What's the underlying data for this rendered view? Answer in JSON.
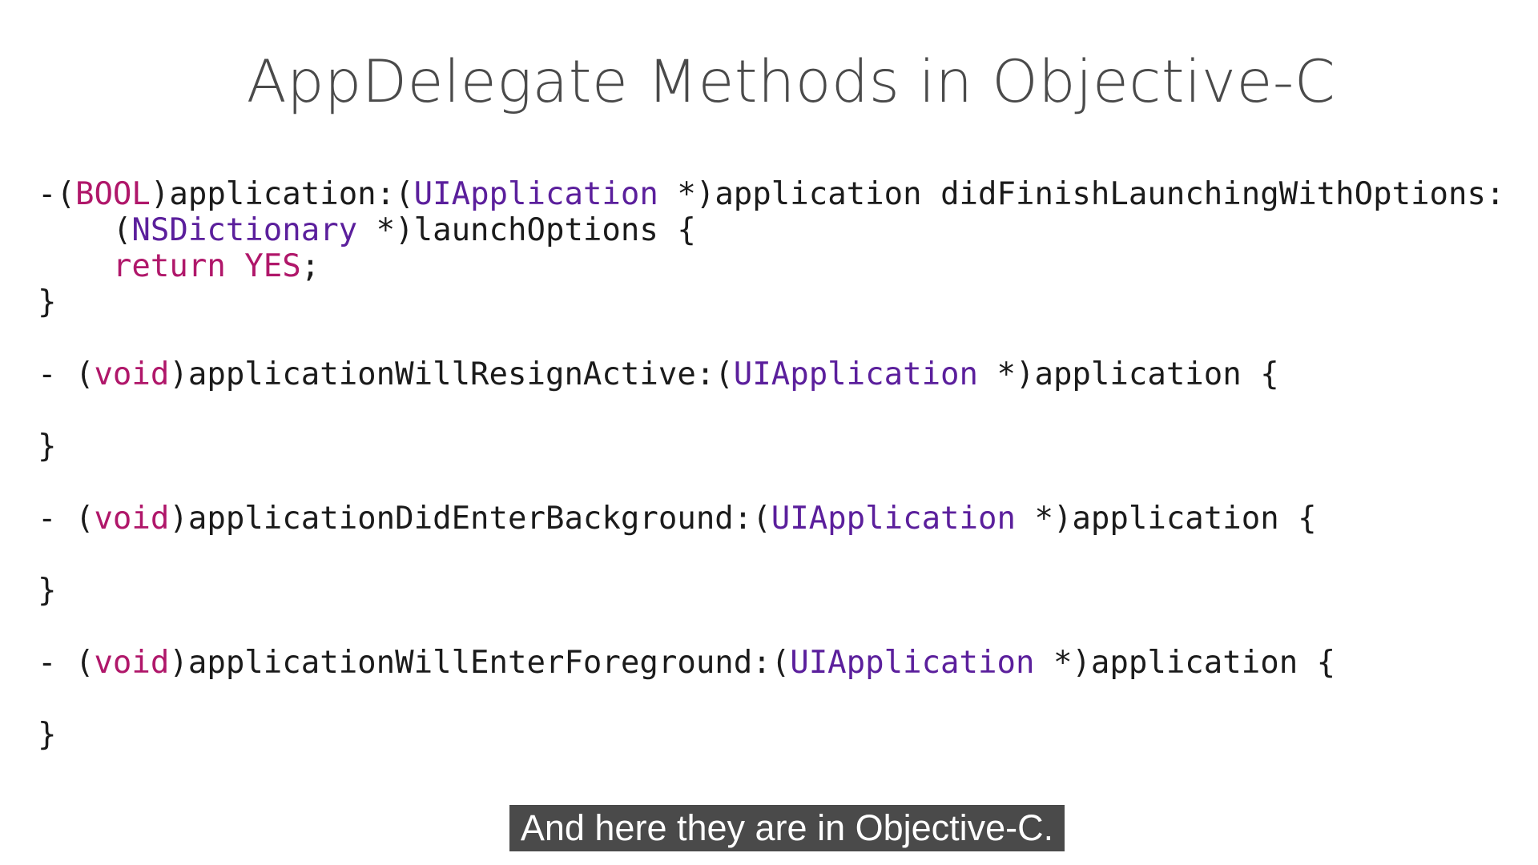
{
  "slide": {
    "title": "AppDelegate Methods in Objective-C"
  },
  "code": {
    "lines": [
      [
        {
          "t": "-(",
          "s": "plain"
        },
        {
          "t": "BOOL",
          "s": "kw"
        },
        {
          "t": ")application:(",
          "s": "plain"
        },
        {
          "t": "UIApplication",
          "s": "type"
        },
        {
          "t": " *)application didFinishLaunchingWithOptions:",
          "s": "plain"
        }
      ],
      [
        {
          "t": "    (",
          "s": "plain"
        },
        {
          "t": "NSDictionary",
          "s": "type"
        },
        {
          "t": " *)launchOptions {",
          "s": "plain"
        }
      ],
      [
        {
          "t": "    ",
          "s": "plain"
        },
        {
          "t": "return",
          "s": "kw"
        },
        {
          "t": " ",
          "s": "plain"
        },
        {
          "t": "YES",
          "s": "kw"
        },
        {
          "t": ";",
          "s": "plain"
        }
      ],
      [
        {
          "t": "}",
          "s": "plain"
        }
      ],
      [],
      [
        {
          "t": "- (",
          "s": "plain"
        },
        {
          "t": "void",
          "s": "kw"
        },
        {
          "t": ")applicationWillResignActive:(",
          "s": "plain"
        },
        {
          "t": "UIApplication",
          "s": "type"
        },
        {
          "t": " *)application {",
          "s": "plain"
        }
      ],
      [],
      [
        {
          "t": "}",
          "s": "plain"
        }
      ],
      [],
      [
        {
          "t": "- (",
          "s": "plain"
        },
        {
          "t": "void",
          "s": "kw"
        },
        {
          "t": ")applicationDidEnterBackground:(",
          "s": "plain"
        },
        {
          "t": "UIApplication",
          "s": "type"
        },
        {
          "t": " *)application {",
          "s": "plain"
        }
      ],
      [],
      [
        {
          "t": "}",
          "s": "plain"
        }
      ],
      [],
      [
        {
          "t": "- (",
          "s": "plain"
        },
        {
          "t": "void",
          "s": "kw"
        },
        {
          "t": ")applicationWillEnterForeground:(",
          "s": "plain"
        },
        {
          "t": "UIApplication",
          "s": "type"
        },
        {
          "t": " *)application {",
          "s": "plain"
        }
      ],
      [],
      [
        {
          "t": "}",
          "s": "plain"
        }
      ]
    ]
  },
  "caption": {
    "text": "And here they are in Objective-C."
  },
  "colors": {
    "background": "#ffffff",
    "title": "#4a4a4a",
    "code_text": "#1b1b1b",
    "keyword": "#b0176a",
    "type_name": "#5b1f9c",
    "caption_bg": "#4a4a4a",
    "caption_text": "#ffffff"
  }
}
